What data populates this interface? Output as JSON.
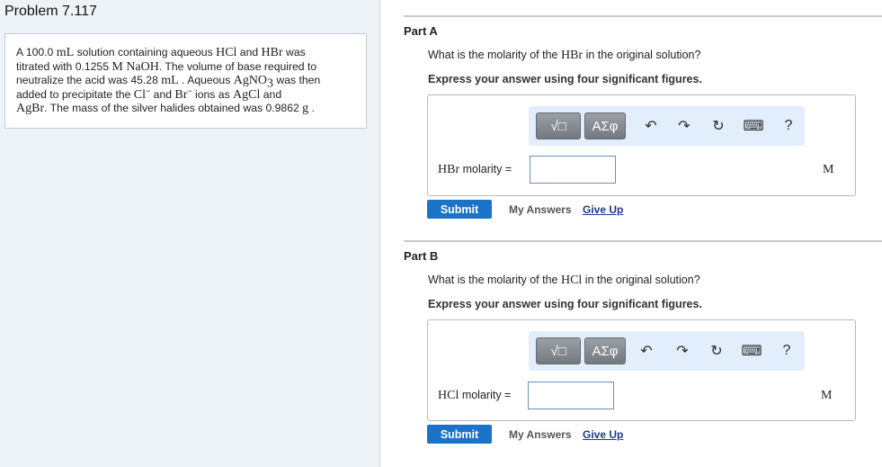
{
  "problem": {
    "title": "Problem 7.117",
    "t1": "A 100.0 ",
    "m1": "mL",
    "t2": " solution containing aqueous ",
    "m2": "HCl",
    "t3": " and ",
    "m3": "HBr",
    "t4": " was",
    "t5": "titrated with 0.1255 ",
    "m4": "M NaOH",
    "t6": ". The volume of base required to",
    "t7": "neutralize the acid was 45.28 ",
    "m5": "mL",
    "t8": " . Aqueous ",
    "m6": "AgNO",
    "m6sub": "3",
    "t9": " was then",
    "t10": "added to precipitate the ",
    "m7": "Cl",
    "m7sup": "−",
    "t11": " and ",
    "m8": "Br",
    "m8sup": "−",
    "t12": " ions as ",
    "m9": "AgCl",
    "t13": " and",
    "m10": "AgBr",
    "t14": ". The mass of the silver halides obtained was 0.9862 ",
    "m11": "g",
    "t15": " ."
  },
  "part_a": {
    "title": "Part A",
    "q_pre": "What is the molarity of the ",
    "q_m": "HBr",
    "q_post": " in the original solution?",
    "instruction": "Express your answer using four significant figures.",
    "label_m": "HBr",
    "label_post": " molarity =",
    "value": "",
    "unit": "M",
    "submit": "Submit",
    "my_answers": "My Answers",
    "give_up": "Give Up"
  },
  "part_b": {
    "title": "Part B",
    "q_pre": "What is the molarity of the ",
    "q_m": "HCl",
    "q_post": " in the original solution?",
    "instruction": "Express your answer using four significant figures.",
    "label_m": "HCl",
    "label_post": " molarity =",
    "value": "",
    "unit": "M",
    "submit": "Submit",
    "my_answers": "My Answers",
    "give_up": "Give Up"
  },
  "toolbar": {
    "template_label": "√□",
    "symbols_label": "ΑΣφ",
    "undo_glyph": "↶",
    "redo_glyph": "↷",
    "reset_glyph": "↻",
    "keyboard_glyph": "⌨",
    "help_glyph": "?",
    "icons": [
      "templates-icon",
      "symbols-icon",
      "undo-icon",
      "redo-icon",
      "reset-icon",
      "keyboard-icon",
      "help-icon"
    ]
  },
  "colors": {
    "accent": "#1a73c9",
    "toolbar_bg": "#e2eefb",
    "panel_bg": "#eef3f8"
  }
}
